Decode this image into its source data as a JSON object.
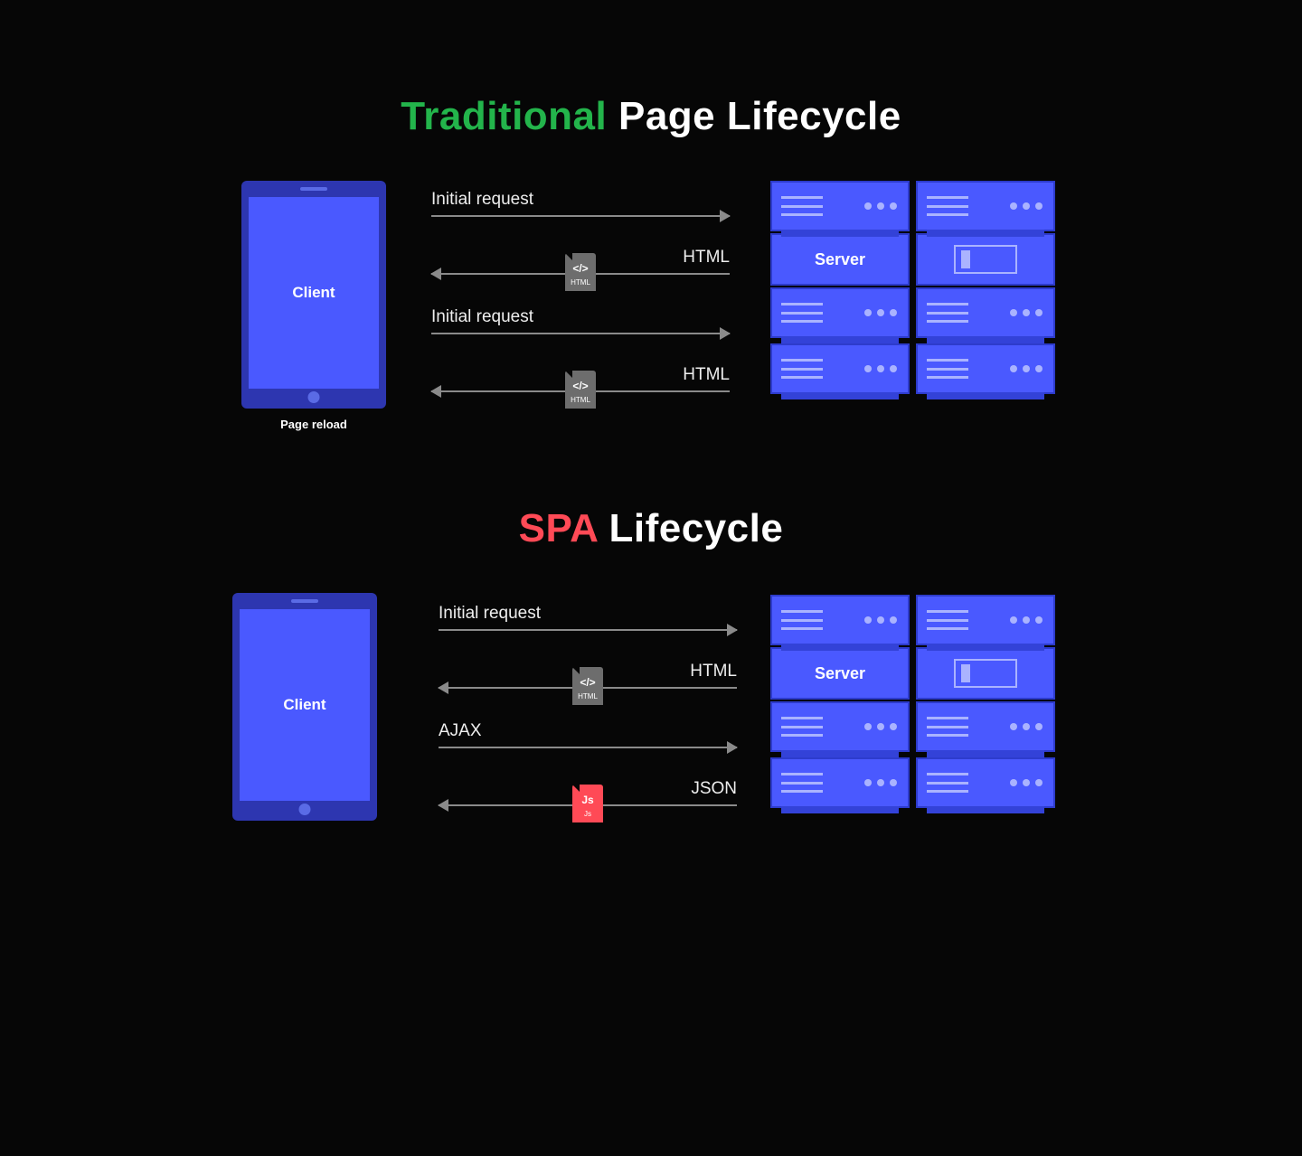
{
  "titles": {
    "t1_accent": "Traditional",
    "t1_rest": " Page Lifecycle",
    "t2_accent": "SPA",
    "t2_rest": " Lifecycle"
  },
  "labels": {
    "client": "Client",
    "server": "Server",
    "page_reload": "Page reload"
  },
  "section1": {
    "r1": "Initial request",
    "r2": "HTML",
    "r3": "Initial request",
    "r4": "HTML"
  },
  "section2": {
    "r1": "Initial request",
    "r2": "HTML",
    "r3": "AJAX",
    "r4": "JSON"
  },
  "chips": {
    "html_sym": "</>",
    "html_ext": "HTML",
    "js_sym": "Js",
    "js_ext": "Js"
  },
  "colors": {
    "green": "#23b44b",
    "red": "#ff4a56",
    "blue": "#4a59ff",
    "darkblue": "#2d36b0"
  }
}
